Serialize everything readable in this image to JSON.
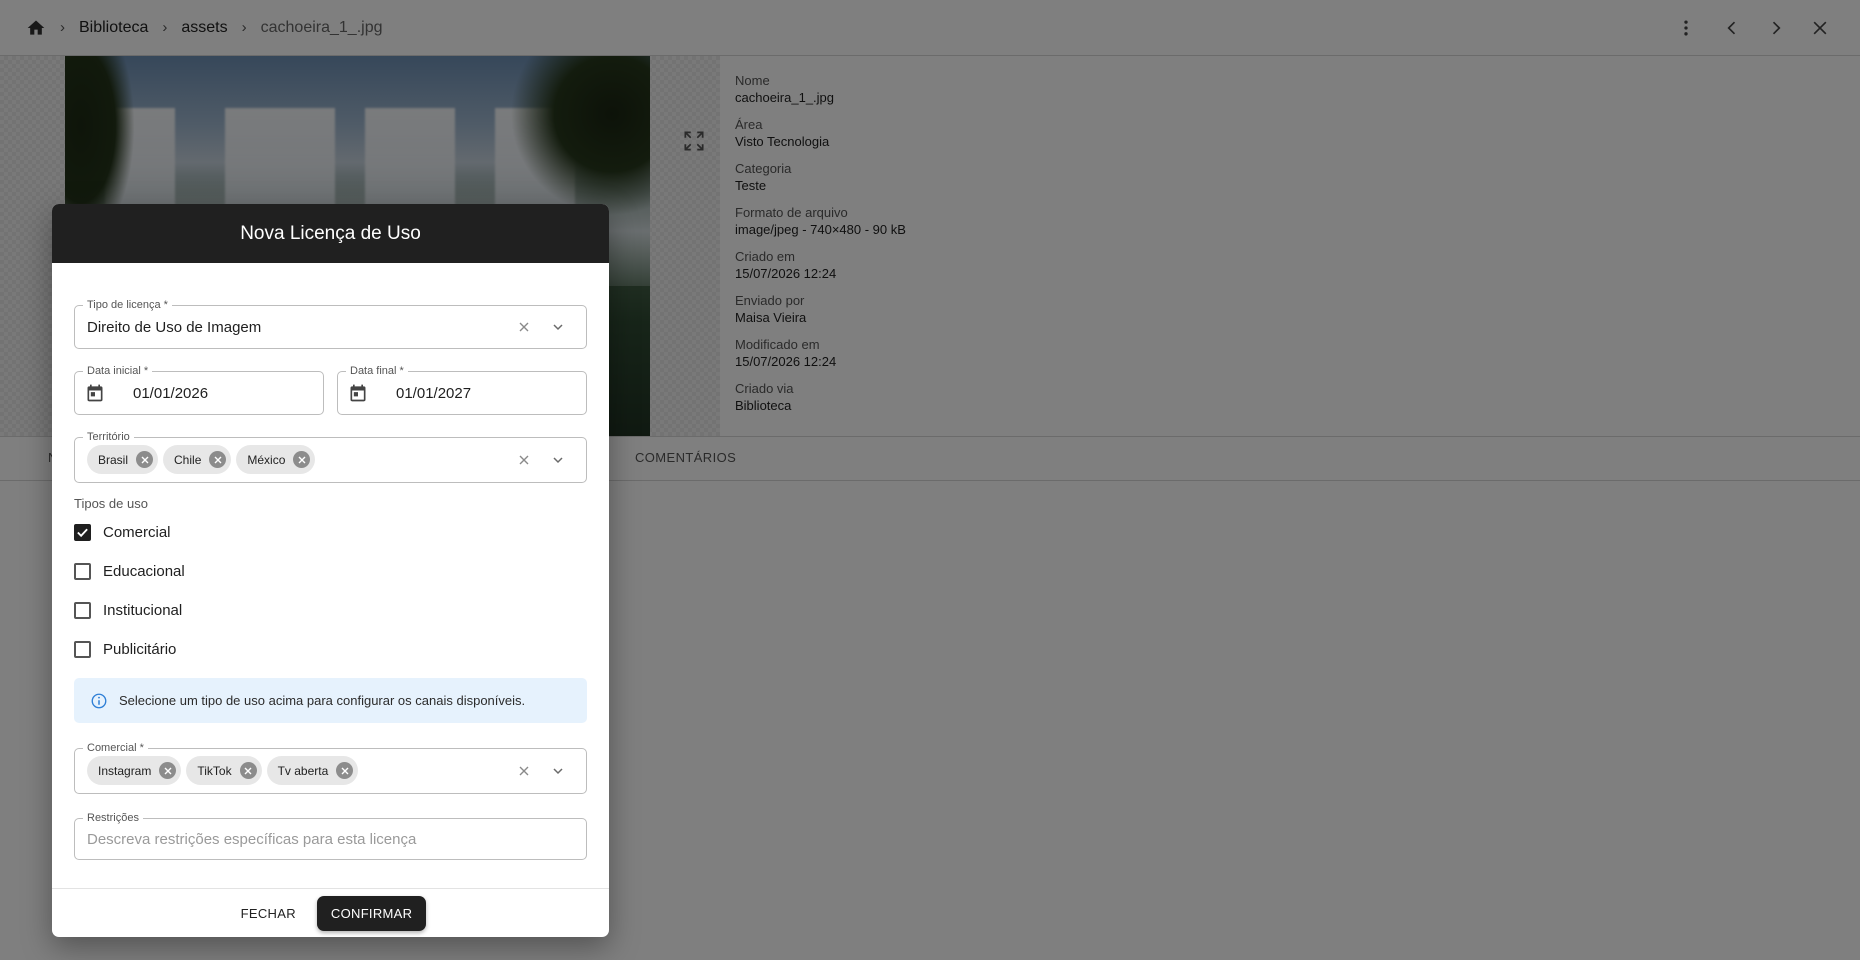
{
  "breadcrumb": {
    "items": [
      "Biblioteca",
      "assets",
      "cachoeira_1_.jpg"
    ]
  },
  "metadata": [
    {
      "label": "Nome",
      "value": "cachoeira_1_.jpg"
    },
    {
      "label": "Área",
      "value": "Visto Tecnologia"
    },
    {
      "label": "Categoria",
      "value": "Teste"
    },
    {
      "label": "Formato de arquivo",
      "value": "image/jpeg - 740×480 - 90 kB"
    },
    {
      "label": "Criado em",
      "value": "15/07/2026 12:24"
    },
    {
      "label": "Enviado por",
      "value": "Maisa Vieira"
    },
    {
      "label": "Modificado em",
      "value": "15/07/2026 12:24"
    },
    {
      "label": "Criado via",
      "value": "Biblioteca"
    }
  ],
  "tabs": {
    "visible": [
      "N",
      "COMENTÁRIOS"
    ]
  },
  "dialog": {
    "title": "Nova Licença de Uso",
    "license_type": {
      "label": "Tipo de licença *",
      "value": "Direito de Uso de Imagem"
    },
    "start_date": {
      "label": "Data inicial *",
      "value": "01/01/2026"
    },
    "end_date": {
      "label": "Data final *",
      "value": "01/01/2027"
    },
    "territory": {
      "label": "Território",
      "chips": [
        "Brasil",
        "Chile",
        "México"
      ]
    },
    "usage_types": {
      "label": "Tipos de uso",
      "options": [
        {
          "label": "Comercial",
          "checked": true
        },
        {
          "label": "Educacional",
          "checked": false
        },
        {
          "label": "Institucional",
          "checked": false
        },
        {
          "label": "Publicitário",
          "checked": false
        }
      ]
    },
    "info_message": "Selecione um tipo de uso acima para configurar os canais disponíveis.",
    "commercial": {
      "label": "Comercial *",
      "chips": [
        "Instagram",
        "TikTok",
        "Tv aberta"
      ]
    },
    "restrictions": {
      "label": "Restrições",
      "placeholder": "Descreva restrições específicas para esta licença"
    },
    "close_label": "FECHAR",
    "confirm_label": "CONFIRMAR"
  },
  "colors": {
    "dialog_header": "#202020",
    "info_background": "#e6f2fd",
    "info_icon": "#2e7fd6",
    "scrim": "rgba(0,0,0,0.5)"
  }
}
